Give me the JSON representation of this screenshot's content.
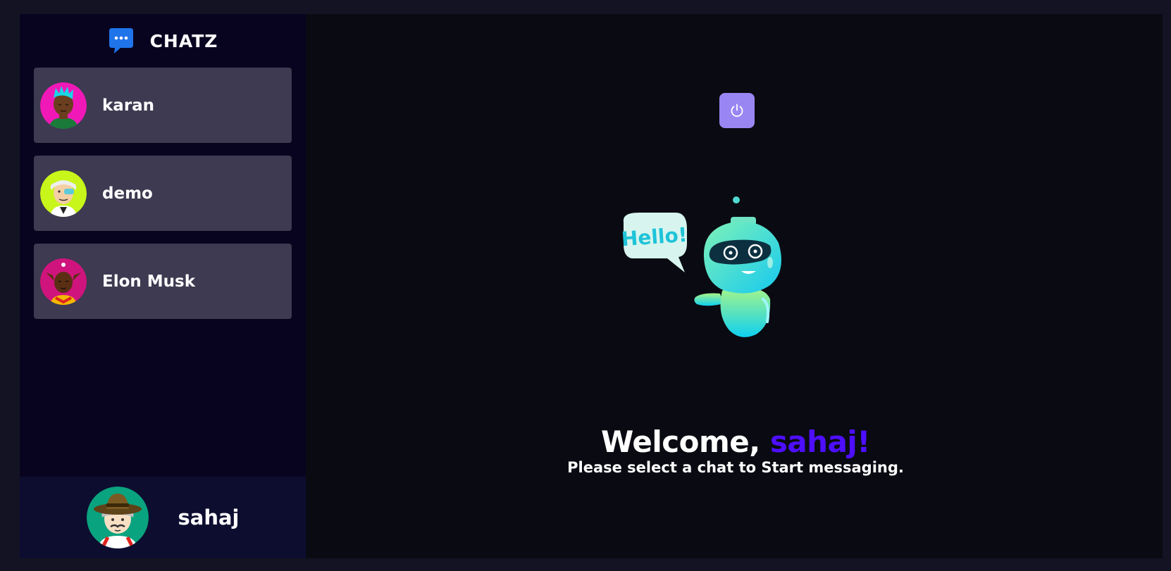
{
  "brand": {
    "name": "CHATZ",
    "icon": "chat-bubble-icon"
  },
  "contacts": [
    {
      "name": "karan",
      "avatar": "avatar-karan"
    },
    {
      "name": "demo",
      "avatar": "avatar-demo"
    },
    {
      "name": "Elon Musk",
      "avatar": "avatar-elon"
    }
  ],
  "current_user": {
    "name": "sahaj",
    "avatar": "avatar-sahaj"
  },
  "logout": {
    "icon": "power-icon"
  },
  "welcome": {
    "prefix": "Welcome, ",
    "username": "sahaj!",
    "subtitle": "Please select a chat to Start messaging.",
    "illustration": "hello-robot",
    "bubble_text": "Hello!"
  },
  "colors": {
    "background": "#131324",
    "sidebar": "#080420",
    "contact_card": "#3d3a51",
    "current_user_bar": "#0d0d30",
    "main": "#0a0b12",
    "accent": "#4e0eff",
    "logout_button": "#9a86f3"
  }
}
